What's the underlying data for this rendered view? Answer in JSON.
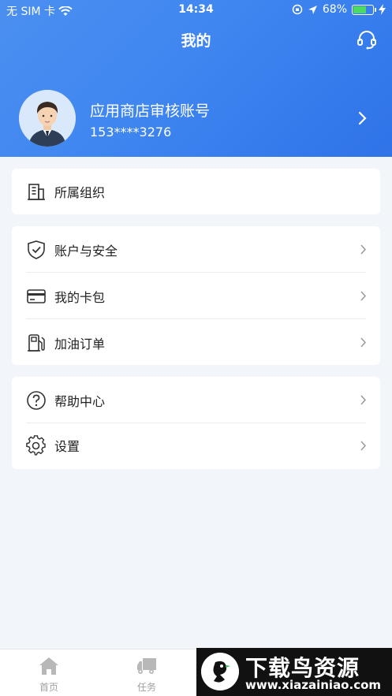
{
  "status_bar": {
    "carrier": "无 SIM 卡",
    "time": "14:34",
    "battery_percent": "68%",
    "battery_level": 0.68
  },
  "nav": {
    "title": "我的"
  },
  "profile": {
    "name": "应用商店审核账号",
    "phone": "153****3276"
  },
  "groups": [
    {
      "items": [
        {
          "label": "所属组织",
          "icon": "building-icon"
        }
      ]
    },
    {
      "items": [
        {
          "label": "账户与安全",
          "icon": "shield-icon"
        },
        {
          "label": "我的卡包",
          "icon": "card-icon"
        },
        {
          "label": "加油订单",
          "icon": "fuel-pump-icon"
        }
      ]
    },
    {
      "items": [
        {
          "label": "帮助中心",
          "icon": "help-icon"
        },
        {
          "label": "设置",
          "icon": "gear-icon"
        }
      ]
    }
  ],
  "tabbar": [
    {
      "label": "首页",
      "icon": "home-icon"
    },
    {
      "label": "任务",
      "icon": "truck-icon"
    }
  ],
  "watermark": {
    "title": "下载鸟资源",
    "url": "www.xiazainiao.com"
  },
  "colors": {
    "header_start": "#4b8ff0",
    "header_end": "#2f73e8",
    "background": "#f2f5f9"
  }
}
